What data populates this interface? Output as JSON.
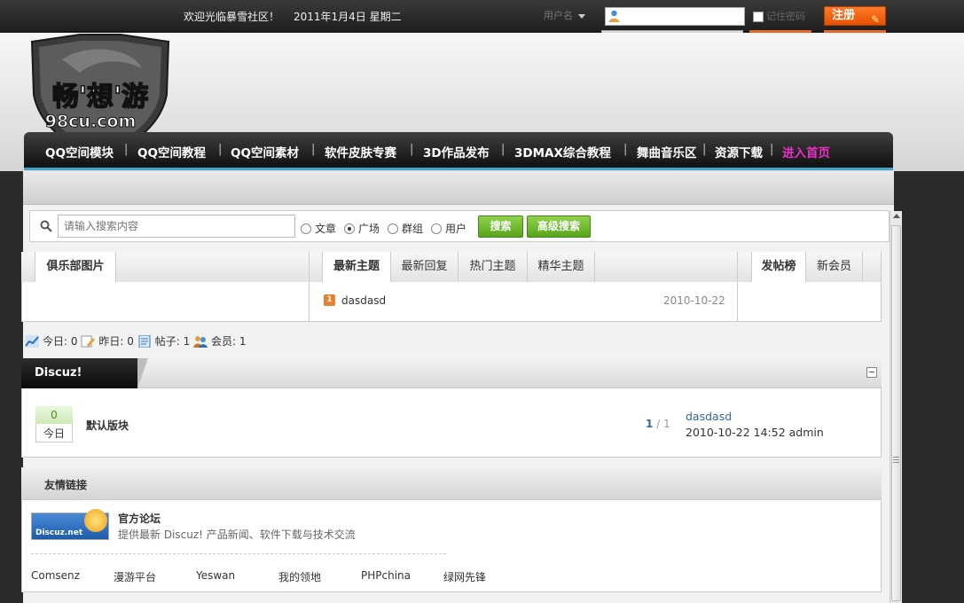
{
  "topbar": {
    "welcome": "欢迎光临暴雪社区！",
    "date": "2011年1月4日 星期二",
    "user_select_label": "用户名",
    "remember_label": "记住密码",
    "register_label": "注册"
  },
  "logo": {
    "main_text": "畅'想'游",
    "sub_text": "98cu.com"
  },
  "nav": {
    "items": [
      "QQ空间模块",
      "QQ空间教程",
      "QQ空间素材",
      "软件皮肤专赛",
      "3D作品发布",
      "3DMAX综合教程",
      "舞曲音乐区",
      "资源下载"
    ],
    "separator": "|",
    "home": "进入首页"
  },
  "search": {
    "placeholder": "请输入搜索内容",
    "options": [
      "文章",
      "广场",
      "群组",
      "用户"
    ],
    "selected": "广场",
    "search_button": "搜索",
    "advanced_button": "高级搜索"
  },
  "tabs": {
    "club_pics": "俱乐部图片",
    "topic_tabs": [
      "最新主题",
      "最新回复",
      "热门主题",
      "精华主题"
    ],
    "member_tabs": [
      "发帖榜",
      "新会员"
    ],
    "latest_topic": {
      "rank": "1",
      "title": "dasdasd",
      "date": "2010-10-22"
    }
  },
  "stats": {
    "today_label": "今日:",
    "today_value": "0",
    "yesterday_label": "昨日:",
    "yesterday_value": "0",
    "posts_label": "帖子:",
    "posts_value": "1",
    "members_label": "会员:",
    "members_value": "1"
  },
  "category": {
    "title": "Discuz!",
    "forum": {
      "today_count": "0",
      "today_label": "今日",
      "name": "默认版块",
      "page_current": "1",
      "page_total": "/ 1",
      "last_post_title": "dasdasd",
      "last_post_info": "2010-10-22 14:52 admin"
    }
  },
  "links": {
    "title": "友情链接",
    "logo_text": "Discuz.net",
    "official_name": "官方论坛",
    "official_desc": "提供最新 Discuz! 产品新闻、软件下载与技术交流",
    "items": [
      "Comsenz",
      "漫游平台",
      "Yeswan",
      "我的领地",
      "PHPchina",
      "绿网先锋"
    ]
  },
  "colors": {
    "nav_home": "#e92fc8",
    "accent_green": "#58a41c",
    "register_orange": "#e45100",
    "link_blue": "#336699"
  }
}
